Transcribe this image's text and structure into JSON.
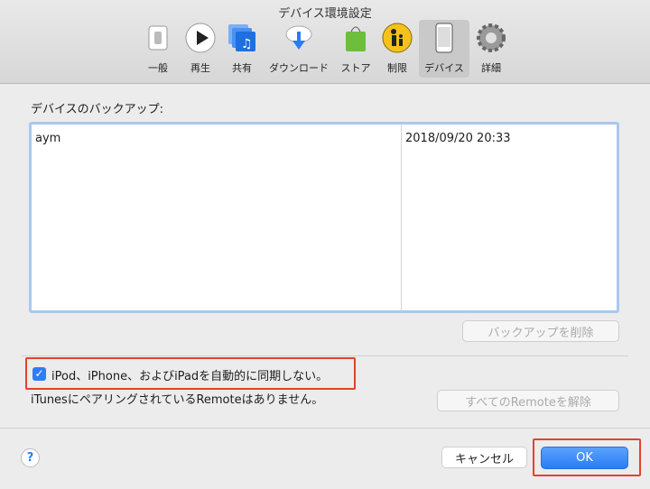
{
  "window": {
    "title": "デバイス環境設定"
  },
  "toolbar": {
    "items": [
      {
        "label": "一般",
        "icon": "switch-icon"
      },
      {
        "label": "再生",
        "icon": "play-icon"
      },
      {
        "label": "共有",
        "icon": "music-share-icon"
      },
      {
        "label": "ダウンロード",
        "icon": "cloud-download-icon"
      },
      {
        "label": "ストア",
        "icon": "shopping-bag-icon"
      },
      {
        "label": "制限",
        "icon": "parental-control-icon"
      },
      {
        "label": "デバイス",
        "icon": "iphone-icon",
        "selected": true
      },
      {
        "label": "詳細",
        "icon": "gear-icon"
      }
    ]
  },
  "backups": {
    "label": "デバイスのバックアップ:",
    "rows": [
      {
        "name": "aym",
        "date": "2018/09/20 20:33"
      }
    ],
    "delete_button": "バックアップを削除"
  },
  "sync": {
    "checkbox_label": "iPod、iPhone、およびiPadを自動的に同期しない。",
    "checked": true
  },
  "remote": {
    "status": "iTunesにペアリングされているRemoteはありません。",
    "unpair_button": "すべてのRemoteを解除"
  },
  "footer": {
    "help": "?",
    "cancel": "キャンセル",
    "ok": "OK"
  },
  "colors": {
    "accent": "#2a7cf5",
    "highlight": "#e0442a",
    "table_border": "#a9c8ec"
  }
}
